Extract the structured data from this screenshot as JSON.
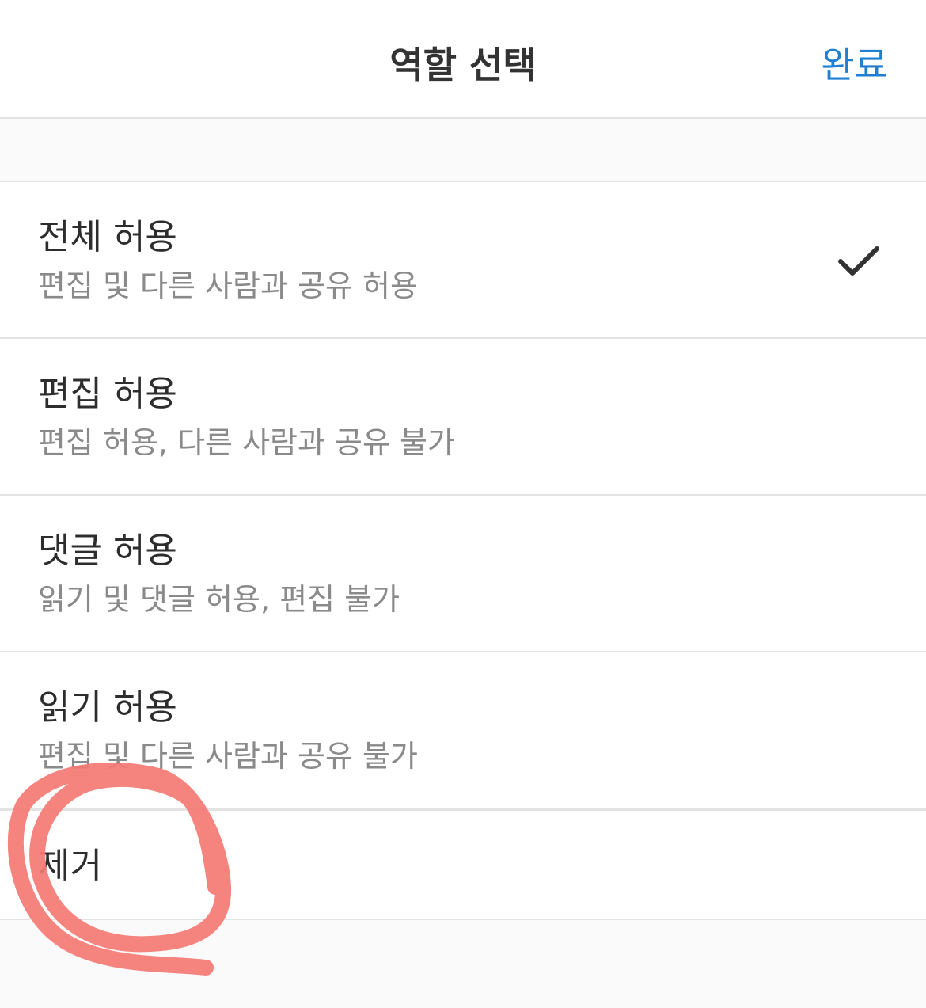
{
  "header": {
    "title": "역할 선택",
    "done_label": "완료",
    "accent_color": "#1e7fd3"
  },
  "roles": [
    {
      "title": "전체 허용",
      "description": "편집 및 다른 사람과 공유 허용",
      "selected": true
    },
    {
      "title": "편집 허용",
      "description": "편집 허용, 다른 사람과 공유 불가",
      "selected": false
    },
    {
      "title": "댓글 허용",
      "description": "읽기 및 댓글 허용, 편집 불가",
      "selected": false
    },
    {
      "title": "읽기 허용",
      "description": "편집 및 다른 사람과 공유 불가",
      "selected": false
    }
  ],
  "remove": {
    "label": "제거"
  },
  "icons": {
    "selected_indicator": "checkmark-icon"
  },
  "annotation": {
    "color": "#f47a73",
    "shape": "hand-drawn circle around remove option"
  }
}
